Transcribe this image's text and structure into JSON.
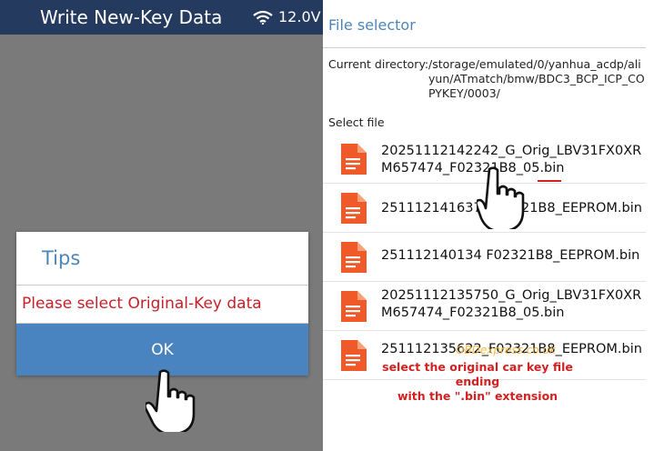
{
  "left_panel": {
    "title": "Write New-Key Data",
    "voltage": "12.0V",
    "dialog": {
      "title": "Tips",
      "message": "Please select Original-Key data",
      "ok_label": "OK"
    }
  },
  "right_panel": {
    "title": "File selector",
    "current_directory_label": "Current directory:",
    "current_directory_path": "/storage/emulated/0/yanhua_acdp/aliyun/ATmatch/bmw/BDC3_BCP_ICP_COPYKEY/0003/",
    "select_file_label": "Select file",
    "files": [
      {
        "name": "20251112142242_G_Orig_LBV31FX0XRM657474_F02321B8_05.bin"
      },
      {
        "name": "251112141637_F02321B8_EEPROM.bin"
      },
      {
        "name": "251112140134 F02321B8_EEPROM.bin"
      },
      {
        "name": "20251112135750_G_Orig_LBV31FX0XRM657474_F02321B8_05.bin"
      },
      {
        "name": "251112135622_F02321B8_EEPROM.bin"
      }
    ],
    "watermark": "OBDexpress.co.uk",
    "annotation_line1": "select the original car key file ending",
    "annotation_line2": "with the \".bin\" extension"
  },
  "icons": {
    "wifi": "wifi-icon",
    "file": "file-icon",
    "pointer": "pointing-hand-icon"
  },
  "colors": {
    "header_bg": "#243a5e",
    "accent_blue": "#4a84c0",
    "title_blue": "#4f86b8",
    "alert_red": "#c8202a",
    "file_icon_orange": "#f05a28"
  }
}
